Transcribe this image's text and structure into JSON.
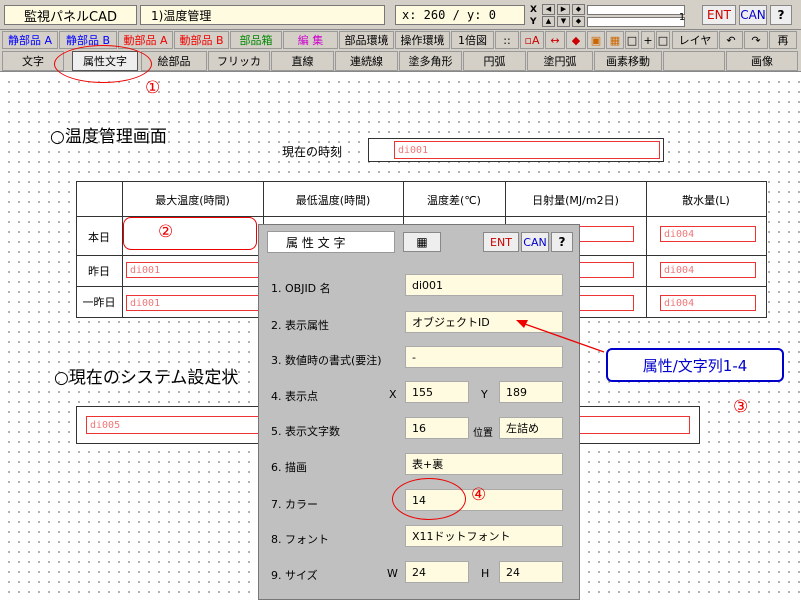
{
  "app": {
    "title": "監視パネルCAD",
    "subtitle": "1)温度管理",
    "coord": "x: 260 / y:   0",
    "xy_x": "X",
    "xy_y": "Y",
    "counter": "1",
    "ent": "ENT",
    "can": "CAN",
    "help": "?"
  },
  "toolbar1": [
    "静部品 A",
    "静部品 B",
    "動部品 A",
    "動部品 B",
    "部品箱",
    "編 集",
    "部品環境",
    "操作環境",
    "1倍図",
    "::",
    "▫A",
    "↔",
    "◆",
    "▣",
    "▦",
    "□",
    "+",
    "□",
    "レイヤ",
    "↶",
    "↷",
    "再"
  ],
  "toolbar2": [
    "文字",
    "属性文字",
    "絵部品",
    "フリッカ",
    "直線",
    "連続線",
    "塗多角形",
    "円弧",
    "塗円弧",
    "画素移動",
    "",
    "画像"
  ],
  "page": {
    "heading1": "○温度管理画面",
    "time_label": "現在の時刻",
    "time_field": "di001",
    "heading2": "○現在のシステム設定状",
    "sys_field": "di005"
  },
  "table": {
    "headers": [
      "",
      "最大温度(時間)",
      "最低温度(時間)",
      "温度差(℃)",
      "日射量(MJ/m2日)",
      "散水量(L)"
    ],
    "rows": [
      {
        "label": "本日",
        "c1": "",
        "c5": "di004"
      },
      {
        "label": "昨日",
        "c1": "di001",
        "c5": "di004"
      },
      {
        "label": "一昨日",
        "c1": "di001",
        "c5": "di004"
      }
    ]
  },
  "dialog": {
    "title": "属 性 文 字",
    "ent": "ENT",
    "can": "CAN",
    "help": "?",
    "items": [
      {
        "label": "1. OBJID 名",
        "value": "di001"
      },
      {
        "label": "2. 表示属性",
        "value": "オブジェクトID"
      },
      {
        "label": "3. 数値時の書式(要注)",
        "value": "-"
      },
      {
        "label": "4. 表示点",
        "x_label": "X",
        "x": "155",
        "y_label": "Y",
        "y": "189"
      },
      {
        "label": "5. 表示文字数",
        "value": "16",
        "pos_label": "位置",
        "pos": "左詰め"
      },
      {
        "label": "6. 描画",
        "value": "表+裏"
      },
      {
        "label": "7. カラー",
        "value": "14"
      },
      {
        "label": "8. フォント",
        "value": "X11ドットフォント"
      },
      {
        "label": "9. サイズ",
        "w_label": "W",
        "w": "24",
        "h_label": "H",
        "h": "24"
      }
    ]
  },
  "annotations": {
    "n1": "①",
    "n2": "②",
    "n3": "③",
    "n4": "④",
    "callout": "属性/文字列1-4",
    "callout_color": "#0000cc",
    "mark_color": "#ee0000"
  }
}
